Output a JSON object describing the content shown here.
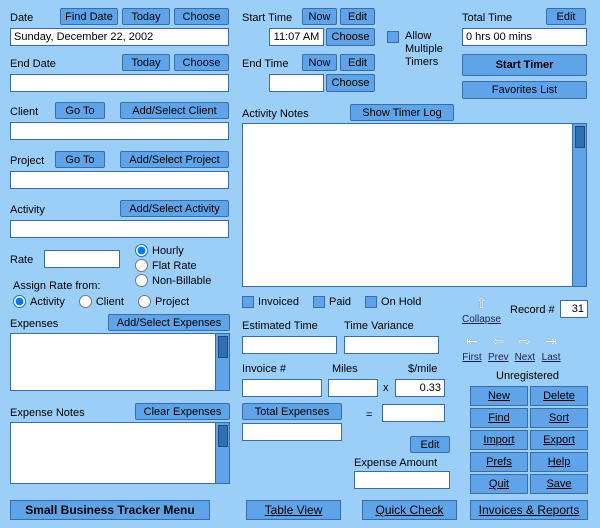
{
  "labels": {
    "date": "Date",
    "endDate": "End Date",
    "client": "Client",
    "project": "Project",
    "activity": "Activity",
    "rate": "Rate",
    "assignRateFrom": "Assign Rate from:",
    "expenses": "Expenses",
    "expenseNotes": "Expense Notes",
    "startTime": "Start Time",
    "endTime": "End Time",
    "activityNotes": "Activity Notes",
    "allowMultipleTimers": "Allow Multiple Timers",
    "totalTime": "Total Time",
    "invoiced": "Invoiced",
    "paid": "Paid",
    "onHold": "On Hold",
    "estimatedTime": "Estimated Time",
    "timeVariance": "Time Variance",
    "invoiceNumber": "Invoice #",
    "miles": "Miles",
    "perMile": "$/mile",
    "totalExpenses": "Total Expenses",
    "expenseAmount": "Expense Amount",
    "recordNumber": "Record #",
    "unregistered": "Unregistered",
    "collapse": "Collapse",
    "x": "x",
    "equals": "="
  },
  "buttons": {
    "findDate": "Find Date",
    "today": "Today",
    "choose": "Choose",
    "goTo": "Go To",
    "addSelectClient": "Add/Select Client",
    "addSelectProject": "Add/Select Project",
    "addSelectActivity": "Add/Select Activity",
    "addSelectExpenses": "Add/Select Expenses",
    "clearExpenses": "Clear Expenses",
    "now": "Now",
    "edit": "Edit",
    "showTimerLog": "Show Timer Log",
    "startTimer": "Start Timer",
    "favoritesList": "Favorites List",
    "new": "New",
    "delete": "Delete",
    "find": "Find",
    "sort": "Sort",
    "import": "Import",
    "export": "Export",
    "prefs": "Prefs",
    "help": "Help",
    "quit": "Quit",
    "save": "Save",
    "sbtMenu": "Small Business Tracker Menu",
    "tableView": "Table View",
    "quickCheck": "Quick Check",
    "invoicesReports": "Invoices & Reports"
  },
  "nav": {
    "first": "First",
    "prev": "Prev",
    "next": "Next",
    "last": "Last"
  },
  "values": {
    "date": "Sunday, December 22, 2002",
    "startTime": "11:07 AM",
    "totalTime": "0 hrs 00 mins",
    "perMileRate": "0.33",
    "recordNumber": "31"
  },
  "radios": {
    "rateType": {
      "hourly": "Hourly",
      "flatRate": "Flat Rate",
      "nonBillable": "Non-Billable",
      "selected": "hourly"
    },
    "assignFrom": {
      "activity": "Activity",
      "client": "Client",
      "project": "Project",
      "selected": "activity"
    }
  }
}
